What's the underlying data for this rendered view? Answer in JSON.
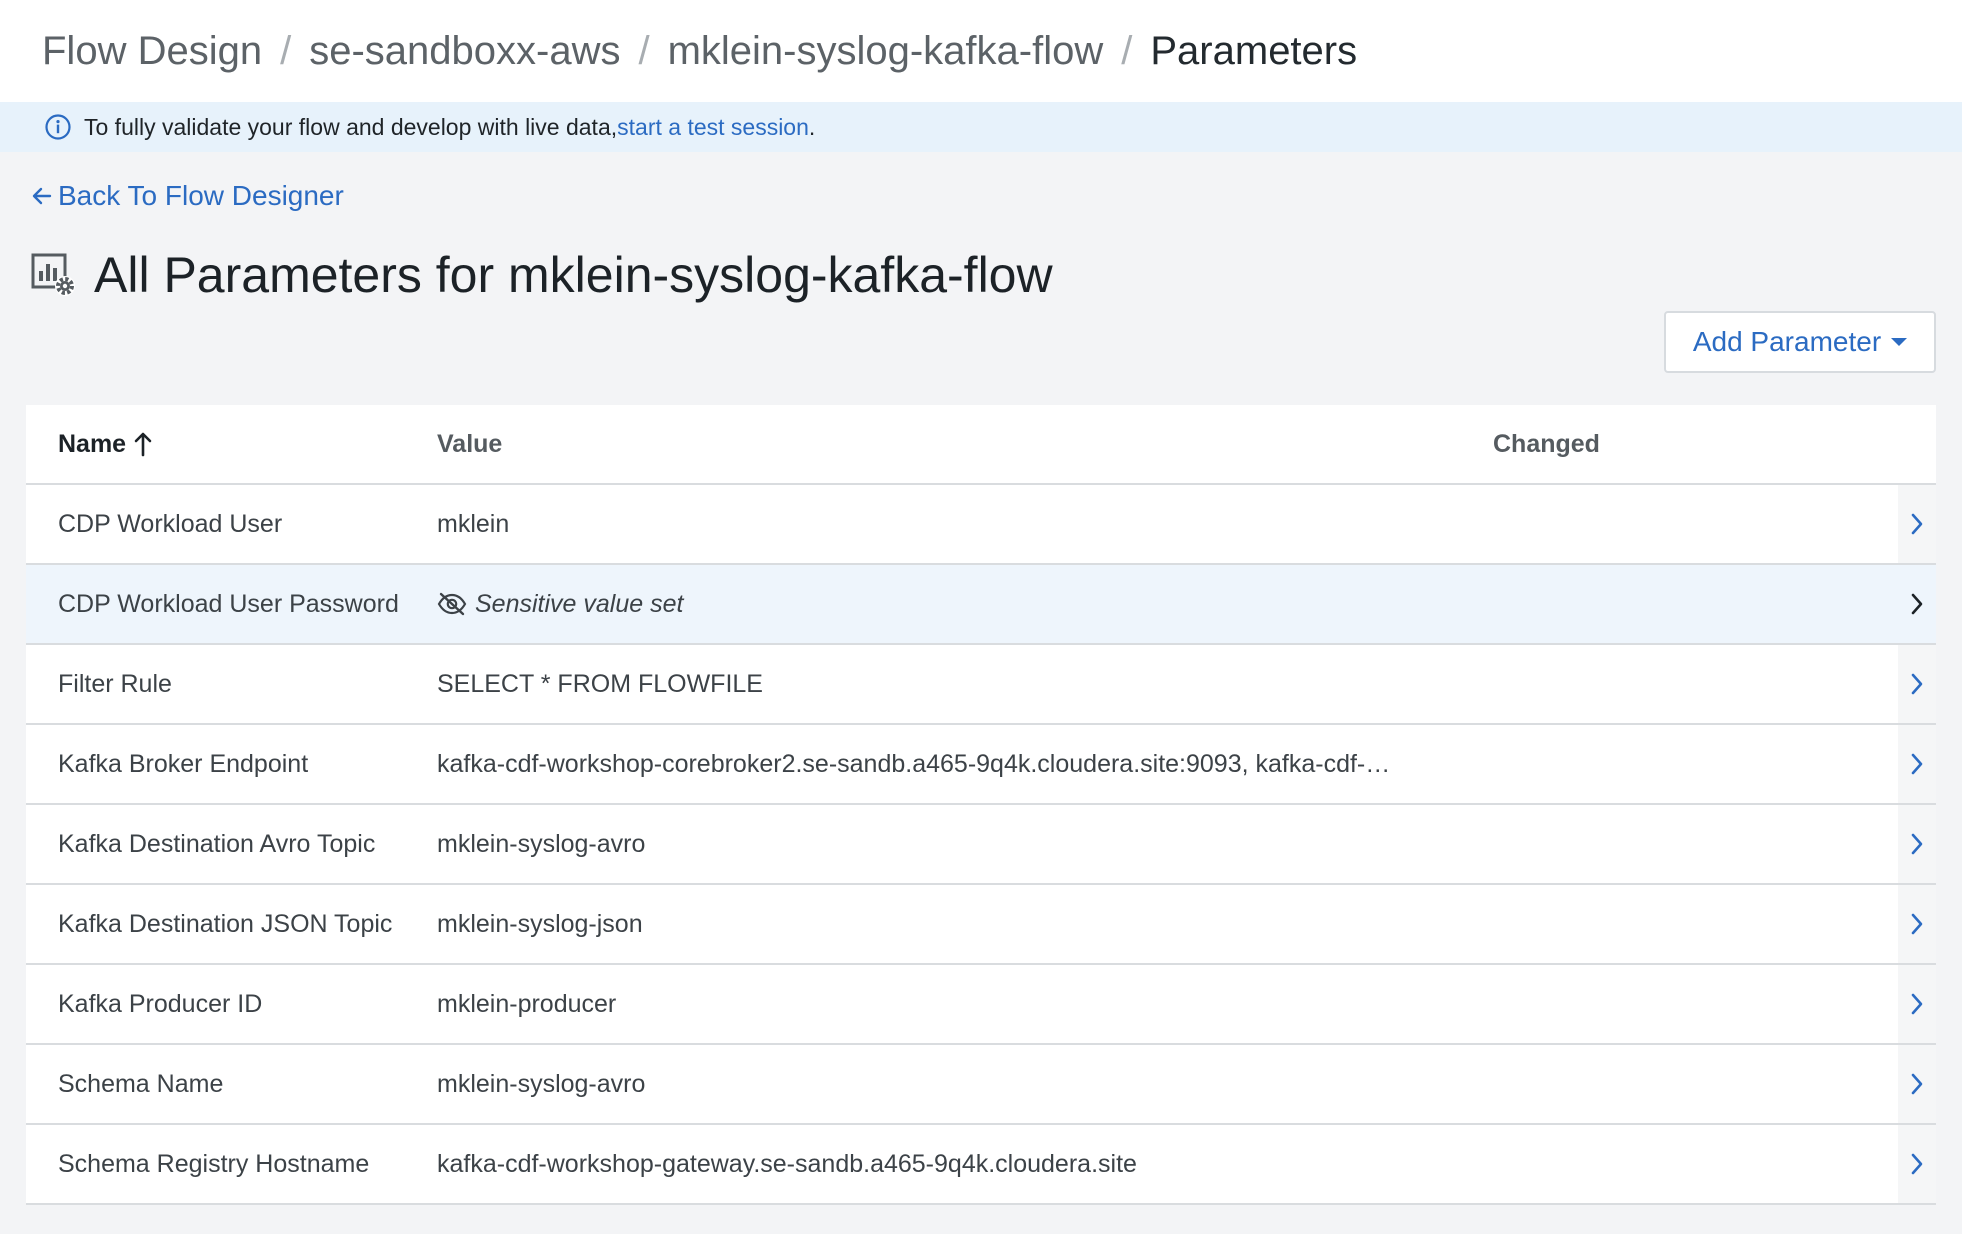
{
  "breadcrumb": [
    "Flow Design",
    "se-sandboxx-aws",
    "mklein-syslog-kafka-flow",
    "Parameters"
  ],
  "banner": {
    "text": "To fully validate your flow and develop with live data, ",
    "link": "start a test session",
    "suffix": "."
  },
  "back_link": "Back To Flow Designer",
  "page_title": "All Parameters for mklein-syslog-kafka-flow",
  "add_button": "Add Parameter",
  "table": {
    "headers": {
      "name": "Name",
      "value": "Value",
      "changed": "Changed"
    },
    "rows": [
      {
        "name": "CDP Workload User",
        "value": "mklein",
        "changed": ""
      },
      {
        "name": "CDP Workload User Password",
        "value": "Sensitive value set",
        "changed": ""
      },
      {
        "name": "Filter Rule",
        "value": "SELECT * FROM FLOWFILE",
        "changed": ""
      },
      {
        "name": "Kafka Broker Endpoint",
        "value": "kafka-cdf-workshop-corebroker2.se-sandb.a465-9q4k.cloudera.site:9093, kafka-cdf-…",
        "changed": ""
      },
      {
        "name": "Kafka Destination Avro Topic",
        "value": "mklein-syslog-avro",
        "changed": ""
      },
      {
        "name": "Kafka Destination JSON Topic",
        "value": "mklein-syslog-json",
        "changed": ""
      },
      {
        "name": "Kafka Producer ID",
        "value": "mklein-producer",
        "changed": ""
      },
      {
        "name": "Schema Name",
        "value": "mklein-syslog-avro",
        "changed": ""
      },
      {
        "name": "Schema Registry Hostname",
        "value": "kafka-cdf-workshop-gateway.se-sandb.a465-9q4k.cloudera.site",
        "changed": ""
      }
    ]
  },
  "colors": {
    "accent": "#2b6bc2",
    "banner_bg": "#e7f2fb",
    "row_highlight": "#eef5fc"
  }
}
